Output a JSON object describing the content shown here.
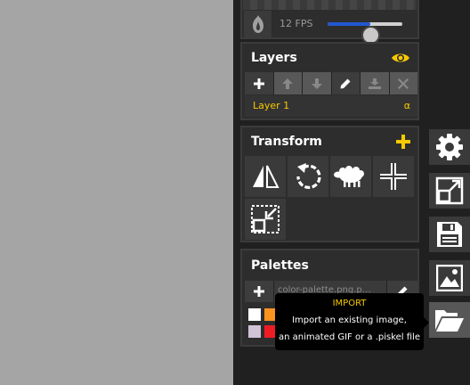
{
  "preview": {
    "fps_label": "12 FPS",
    "fps_value": 12,
    "fps_slider_fraction": 0.57
  },
  "layers": {
    "title": "Layers",
    "items": [
      {
        "name": "Layer 1",
        "alpha": "α"
      }
    ],
    "toolbar_icons": [
      "add-layer-icon",
      "move-layer-up-icon",
      "move-layer-down-icon",
      "edit-layer-icon",
      "merge-layer-icon",
      "delete-layer-icon"
    ]
  },
  "transform": {
    "title": "Transform",
    "tools": [
      "flip-icon",
      "rotate-icon",
      "clone-sheep-icon",
      "center-icon",
      "crop-icon"
    ]
  },
  "palettes": {
    "title": "Palettes",
    "selected": "color-palette.png.p…",
    "swatches": [
      {
        "color": "#ffffff"
      },
      {
        "color": "#f7931e"
      },
      {
        "color": "#d3c3d7"
      },
      {
        "color": "#ee1c24"
      }
    ]
  },
  "sidebar": {
    "buttons": [
      "settings",
      "resize",
      "save",
      "export",
      "import"
    ],
    "active": "import"
  },
  "tooltip": {
    "title": "IMPORT",
    "line1": "Import an existing image,",
    "line2": "an animated GIF or a .piskel file"
  },
  "colors": {
    "accent": "#f8c900",
    "slider_fill": "#2257d0",
    "panel": "#2d2d2d"
  }
}
